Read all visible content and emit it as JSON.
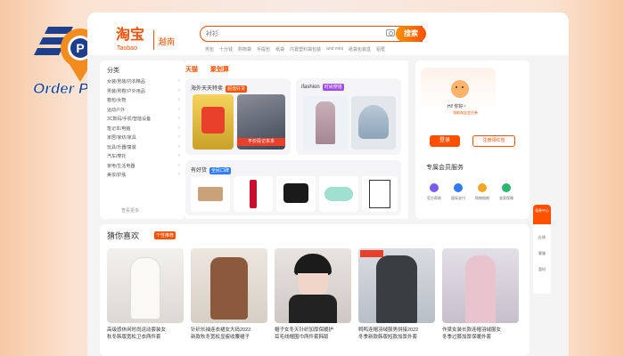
{
  "brand": {
    "name": "Order Plus",
    "registered": "®"
  },
  "header": {
    "logo_text": "淘宝",
    "logo_sub": "Taobao",
    "region": "越南",
    "search_placeholder": "衬衫",
    "search_button": "搜索",
    "hot_words": [
      "男包",
      "十分钱",
      "购物袋",
      "手提包",
      "纸袋",
      "内置塑料袋包装",
      "and mini",
      "纸袋包装盒",
      "铝框"
    ]
  },
  "categories": {
    "title": "分类",
    "items": [
      "女装/男装/内衣精品",
      "男装/男鞋/户外用品",
      "箱包/女鞋",
      "运动户外",
      "3C数码/手机/智能设备",
      "笔记本/电脑",
      "家居/家纺/家具",
      "玩具/乐器/童装",
      "汽车/摩托",
      "家电/生活电器",
      "美妆/护肤"
    ],
    "more": "查看更多"
  },
  "center": {
    "tabs": [
      "天猫",
      "聚划算"
    ],
    "card1": {
      "title": "海外天天特卖",
      "tag": "超值好货"
    },
    "card2": {
      "title": "ifashion",
      "tag": "时尚穿搭"
    },
    "card3": {
      "title": "有好货",
      "tag": "全民口碑"
    },
    "book_banner": "平价段记本本"
  },
  "user": {
    "greeting": "Hi! 你好~",
    "sub": "领取淘宝会员券",
    "login": "登录",
    "register": "注册领红包",
    "member_title": "专属会员服务",
    "services": [
      "官方帮助",
      "国际支付",
      "购物指南",
      "卖家保障"
    ]
  },
  "guess": {
    "title": "猜你喜欢",
    "tag": "个性推荐",
    "products": [
      {
        "line1": "高级感休闲时尚运动套装女",
        "line2": "秋冬韩版宽松卫衣两件套"
      },
      {
        "line1": "针织长袖连衣裙女大码2022",
        "line2": "新款秋冬宽松显瘦收腰裙子"
      },
      {
        "line1": "帽子女冬天针织加厚保暖护",
        "line2": "耳毛线帽围巾两件套韩版"
      },
      {
        "line1": "鸭鸭连帽羽绒服男拼接2022",
        "line2": "冬季新款韩版短款加厚外套"
      },
      {
        "line1": "作梁女装长款连帽羽绒服女",
        "line2": "冬季过膝加厚保暖外套"
      }
    ]
  },
  "side": {
    "top": "领券中心",
    "items": [
      "反馈",
      "客服",
      "暂时"
    ]
  },
  "colors": {
    "accent": "#ff5000",
    "logo_navy": "#1f3f8c",
    "logo_orange": "#f28c1e"
  }
}
